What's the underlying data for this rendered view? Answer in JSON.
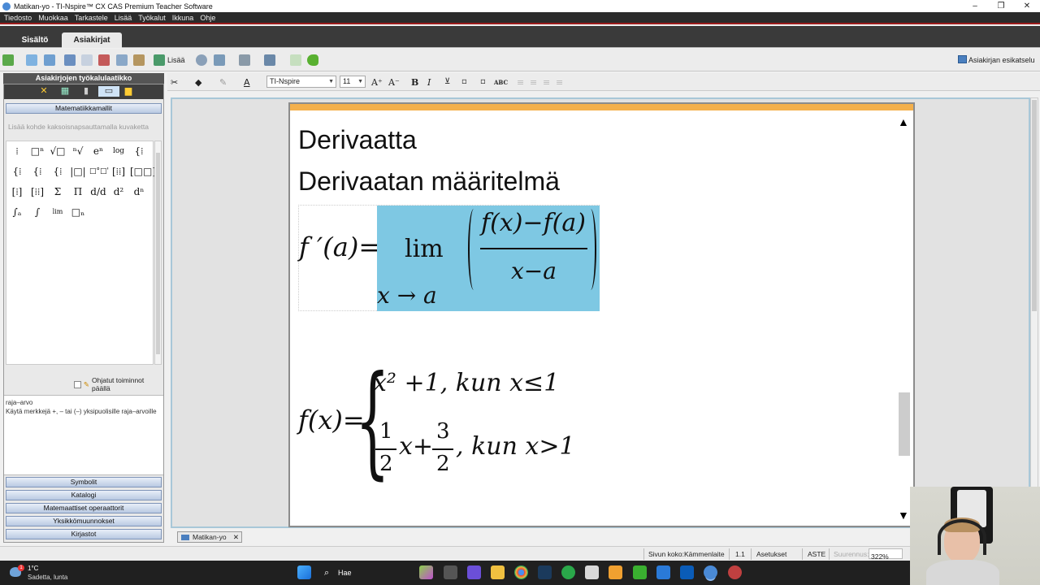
{
  "window": {
    "title": "Matikan-yo - TI-Nspire™ CX CAS Premium Teacher Software",
    "minimize": "–",
    "maximize": "❐",
    "close": "✕"
  },
  "menu": [
    "Tiedosto",
    "Muokkaa",
    "Tarkastele",
    "Lisää",
    "Työkalut",
    "Ikkuna",
    "Ohje"
  ],
  "tabs": {
    "content": "Sisältö",
    "documents": "Asiakirjat"
  },
  "toolbar": {
    "insert_label": "Lisää",
    "preview_label": "Asiakirjan esikatselu"
  },
  "left_panel": {
    "header": "Asiakirjojen työkalulaatikko",
    "math_templates": "Matematiikkamallit",
    "hint": "Lisää kohde kaksoisnapsauttamalla kuvaketta",
    "guided_label": "Ohjatut toiminnot päällä",
    "help_title": "raja–arvo",
    "help_text": "Käytä merkkejä +, – tai (–) yksipuolisille raja–arvoille",
    "sections": [
      "Symbolit",
      "Katalogi",
      "Matemaattiset operaattorit",
      "Yksikkömuunnokset",
      "Kirjastot"
    ]
  },
  "format": {
    "font": "TI-Nspire",
    "size": "11"
  },
  "document": {
    "heading1": "Derivaatta",
    "heading2": "Derivaatan määritelmä",
    "formula1": {
      "lhs": "f ′(a)=",
      "lim": "lim",
      "sub": "x → a",
      "numerator": "f(x)−f(a)",
      "denominator": "x−a"
    },
    "formula2": {
      "lhs": "f(x)=",
      "case1": "x² +1, kun x≤1",
      "case2_frac1_num": "1",
      "case2_frac1_den": "2",
      "case2_mid": "x+",
      "case2_frac2_num": "3",
      "case2_frac2_den": "2",
      "case2_tail": ", kun x>1"
    }
  },
  "doc_tab": "Matikan-yo",
  "status": {
    "page_size": "Sivun koko:Kämmenlaite",
    "page_num": "1.1",
    "settings": "Asetukset",
    "angle": "ASTE",
    "zoom_label": "Suurennus:",
    "zoom_value": "322%"
  },
  "taskbar": {
    "temp": "1°C",
    "weather": "Sadetta, lunta",
    "search": "Hae",
    "badge": "1"
  },
  "colors": {
    "selection": "#7ec8e3",
    "accent": "#f4b04c",
    "menu_line": "#9b1c1c"
  }
}
